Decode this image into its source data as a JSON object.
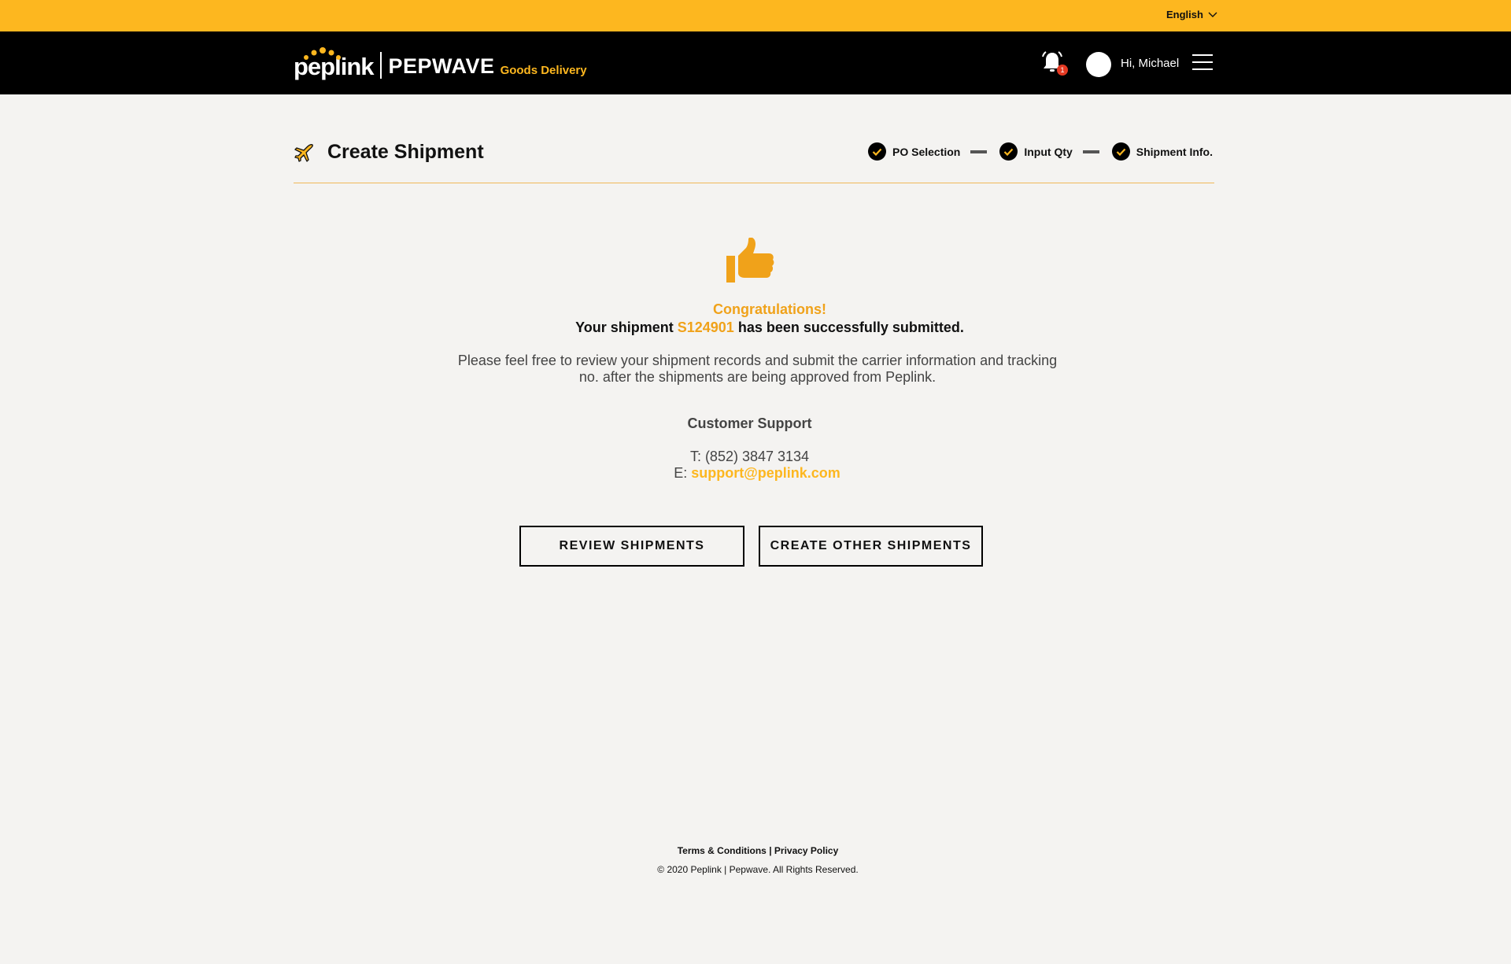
{
  "topbar": {
    "language": "English"
  },
  "header": {
    "logo_brand": "peplink",
    "logo_product": "PEPWAVE",
    "logo_subtitle": "Goods Delivery",
    "notification_count": "1",
    "greeting": "Hi, Michael"
  },
  "page": {
    "title": "Create Shipment",
    "steps": [
      {
        "label": "PO Selection",
        "done": true
      },
      {
        "label": "Input Qty",
        "done": true
      },
      {
        "label": "Shipment Info.",
        "done": true
      }
    ]
  },
  "message": {
    "congrats": "Congratulations!",
    "submitted_prefix": "Your shipment ",
    "shipment_no": "S124901",
    "submitted_suffix": " has been successfully submitted.",
    "info": "Please feel free to review your shipment records and submit the carrier information and tracking no. after the shipments are being approved from Peplink."
  },
  "support": {
    "title": "Customer Support",
    "phone": "T: (852) 3847 3134",
    "email_prefix": "E: ",
    "email": "support@peplink.com"
  },
  "actions": {
    "review_label": "REVIEW SHIPMENTS",
    "create_other_label": "CREATE OTHER SHIPMENTS"
  },
  "footer": {
    "terms": "Terms & Conditions",
    "separator": "|",
    "privacy": "Privacy Policy",
    "copyright": "© 2020 Peplink | Pepwave. All Rights Reserved."
  },
  "colors": {
    "accent_yellow": "#fdb71f",
    "accent_orange": "#f0a21a",
    "header_black": "#000000",
    "background": "#f4f3f1"
  }
}
